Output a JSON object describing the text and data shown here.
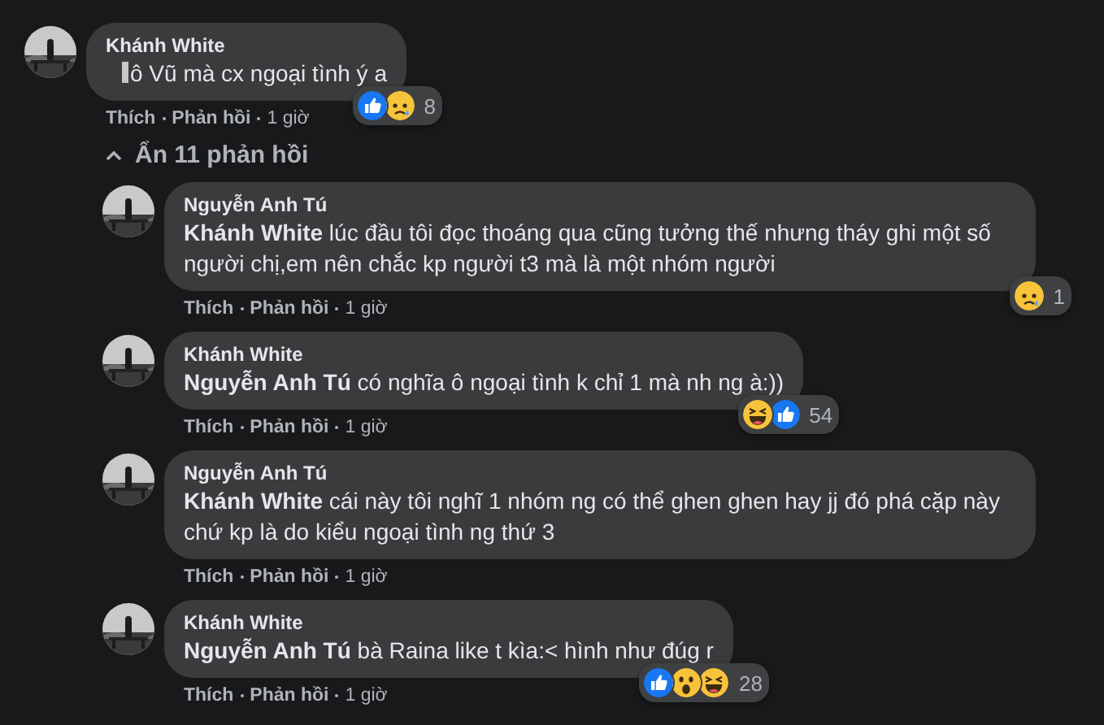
{
  "comment": {
    "author": "Khánh White",
    "text": "ô Vũ mà cx ngoại tình ý a",
    "cursor": true,
    "reactions": [
      {
        "kind": "like"
      },
      {
        "kind": "sad"
      }
    ],
    "reaction_count": "8",
    "actions": [
      "Thích",
      "Phản hồi",
      "1 giờ"
    ]
  },
  "replies_toggle": {
    "label": "Ẩn 11 phản hồi",
    "expanded": true
  },
  "replies": [
    {
      "author": "Nguyễn Anh Tú",
      "text": "**Khánh White** lúc đầu tôi đọc thoáng qua cũng tưởng thế nhưng tháy ghi một số người chị,em nên chắc kp người t3 mà là một nhóm người",
      "reactions": [
        {
          "kind": "sad"
        }
      ],
      "reaction_count": "1",
      "actions": [
        "Thích",
        "Phản hồi",
        "1 giờ"
      ]
    },
    {
      "author": "Khánh White",
      "text": "**Nguyễn Anh Tú** có nghĩa ô ngoại tình k chỉ 1 mà nh ng à:))",
      "reactions": [
        {
          "kind": "haha"
        },
        {
          "kind": "like"
        }
      ],
      "reaction_count": "54",
      "actions": [
        "Thích",
        "Phản hồi",
        "1 giờ"
      ]
    },
    {
      "author": "Nguyễn Anh Tú",
      "text": "**Khánh White** cái này tôi nghĩ 1 nhóm ng có thể ghen ghen hay jj đó phá cặp này chứ kp là do kiểu ngoại tình ng thứ 3",
      "actions": [
        "Thích",
        "Phản hồi",
        "1 giờ"
      ]
    },
    {
      "author": "Khánh White",
      "text": "**Nguyễn Anh Tú** bà Raina like t kìa:< hình như đúg r",
      "reactions": [
        {
          "kind": "like"
        },
        {
          "kind": "wow"
        },
        {
          "kind": "haha"
        }
      ],
      "reaction_count": "28",
      "actions": [
        "Thích",
        "Phản hồi",
        "1 giờ"
      ]
    }
  ]
}
